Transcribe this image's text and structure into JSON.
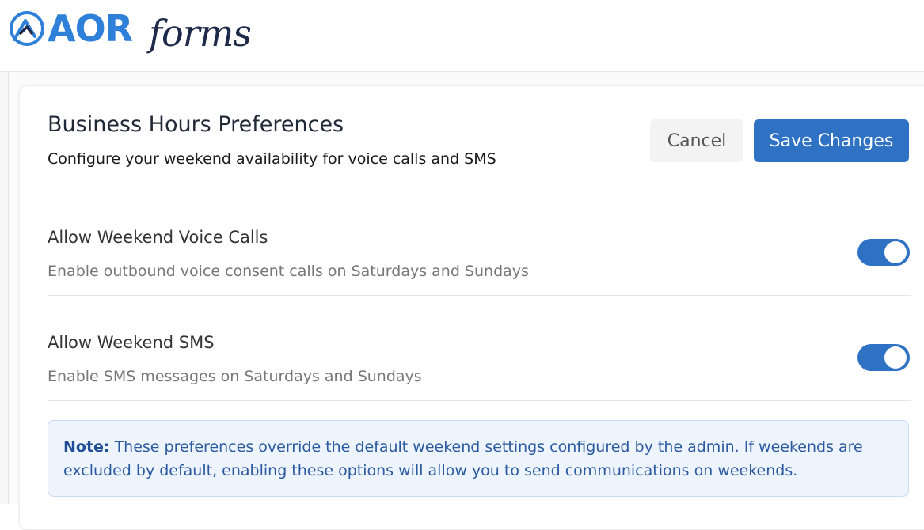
{
  "brand": {
    "logo_primary": "AOR",
    "logo_secondary": "forms",
    "colors": {
      "primary": "#2f80d8",
      "secondary": "#1e2a4a"
    }
  },
  "header": {
    "title": "Business Hours Preferences",
    "subtitle": "Configure your weekend availability for voice calls and SMS"
  },
  "actions": {
    "cancel_label": "Cancel",
    "save_label": "Save Changes"
  },
  "preferences": [
    {
      "label": "Allow Weekend Voice Calls",
      "description": "Enable outbound voice consent calls on Saturdays and Sundays",
      "enabled": true
    },
    {
      "label": "Allow Weekend SMS",
      "description": "Enable SMS messages on Saturdays and Sundays",
      "enabled": true
    }
  ],
  "note": {
    "prefix": "Note:",
    "text": " These preferences override the default weekend settings configured by the admin. If weekends are excluded by default, enabling these options will allow you to send communications on weekends."
  },
  "colors": {
    "accent": "#2f72c4",
    "note_bg": "#eef4fd",
    "note_text": "#2b5aa0"
  }
}
